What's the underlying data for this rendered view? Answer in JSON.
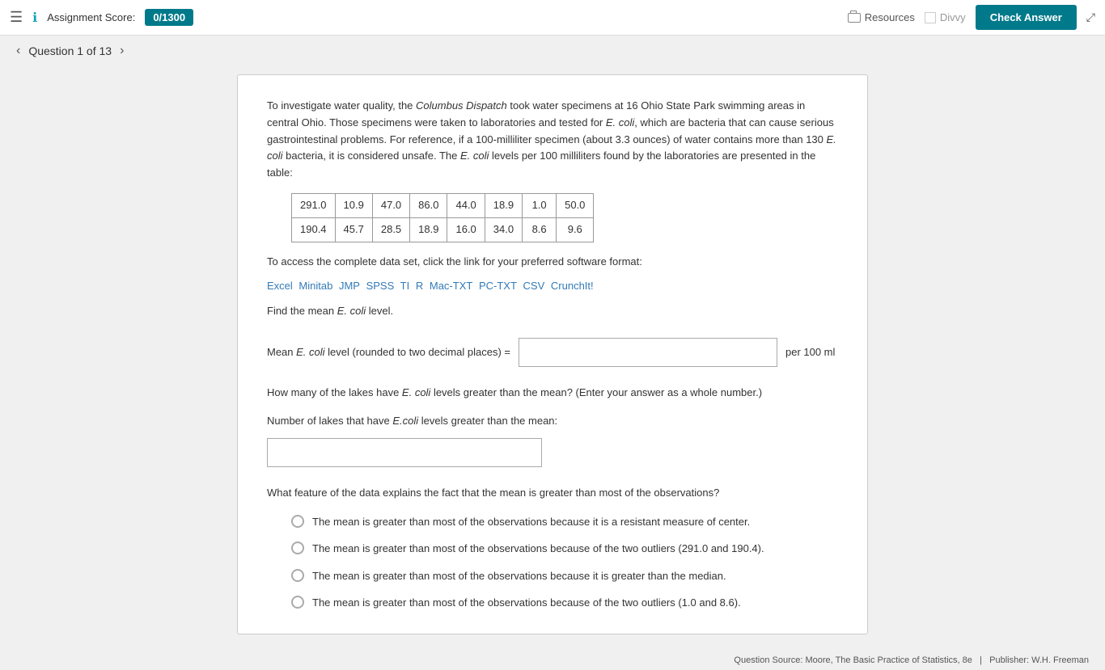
{
  "header": {
    "menu_label": "☰",
    "info_label": "ℹ",
    "assignment_label": "Assignment Score:",
    "score_badge": "0/1300",
    "resources_label": "Resources",
    "divvy_label": "Divvy",
    "check_answer_label": "Check Answer",
    "expand_label": "⤢"
  },
  "nav": {
    "prev_arrow": "‹",
    "next_arrow": "›",
    "question_label": "Question 1 of 13"
  },
  "question": {
    "passage": "To investigate water quality, the Columbus Dispatch took water specimens at 16 Ohio State Park swimming areas in central Ohio. Those specimens were taken to laboratories and tested for E. coli, which are bacteria that can cause serious gastrointestinal problems. For reference, if a 100-milliliter specimen (about 3.3 ounces) of water contains more than 130 E. coli bacteria, it is considered unsafe. The E. coli levels per 100 milliliters found by the laboratories are presented in the table:",
    "table_row1": [
      "291.0",
      "10.9",
      "47.0",
      "86.0",
      "44.0",
      "18.9",
      "1.0",
      "50.0"
    ],
    "table_row2": [
      "190.4",
      "45.7",
      "28.5",
      "18.9",
      "16.0",
      "34.0",
      "8.6",
      "9.6"
    ],
    "data_access_text": "To access the complete data set, click the link for your preferred software format:",
    "data_links": [
      "Excel",
      "Minitab",
      "JMP",
      "SPSS",
      "TI",
      "R",
      "Mac-TXT",
      "PC-TXT",
      "CSV",
      "CrunchIt!"
    ],
    "find_mean_text": "Find the mean E. coli level.",
    "mean_label": "Mean E. coli level (rounded to two decimal places) =",
    "mean_unit": "per 100 ml",
    "mean_input_placeholder": "",
    "lakes_question": "How many of the lakes have E. coli levels greater than the mean? (Enter your answer as a whole number.)",
    "lakes_label": "Number of lakes that have E.coli levels greater than the mean:",
    "lakes_input_placeholder": "",
    "feature_question": "What feature of the data explains the fact that the mean is greater than most of the observations?",
    "radio_options": [
      "The mean is greater than most of the observations because it is a resistant measure of center.",
      "The mean is greater than most of the observations because of the two outliers (291.0 and 190.4).",
      "The mean is greater than most of the observations because it is greater than the median.",
      "The mean is greater than most of the observations because of the two outliers (1.0 and 8.6)."
    ]
  },
  "footer": {
    "source": "Question Source: Moore, The Basic Practice of Statistics, 8e",
    "publisher": "Publisher: W.H. Freeman"
  }
}
